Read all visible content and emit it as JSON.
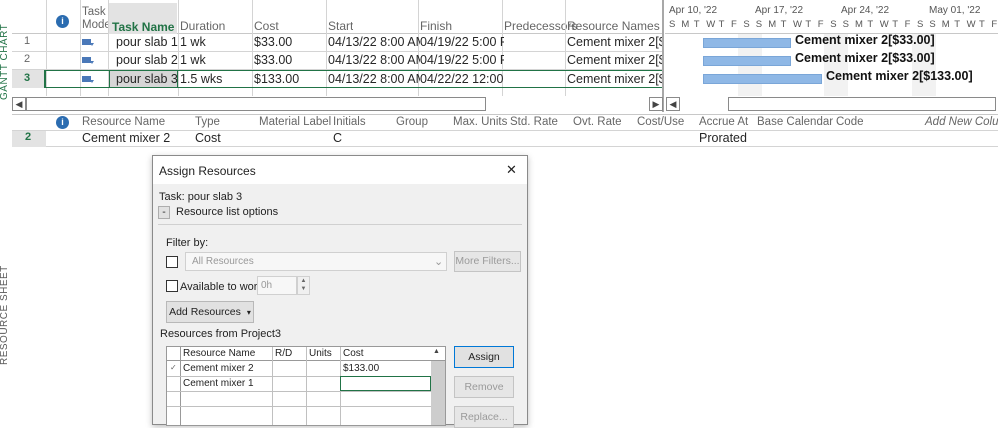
{
  "side_labels": {
    "gantt": "GANTT CHART",
    "resource_sheet": "RESOURCE SHEET"
  },
  "task_table": {
    "headers": {
      "info": "i",
      "mode": "Task Mode",
      "name": "Task Name",
      "duration": "Duration",
      "cost": "Cost",
      "start": "Start",
      "finish": "Finish",
      "predecessors": "Predecessors",
      "resource_names": "Resource Names"
    },
    "rows": [
      {
        "id": "1",
        "name": "pour slab 1",
        "duration": "1 wk",
        "cost": "$33.00",
        "start": "04/13/22 8:00 AM",
        "finish": "04/19/22 5:00 P",
        "resources": "Cement mixer 2[$3"
      },
      {
        "id": "2",
        "name": "pour slab 2",
        "duration": "1 wk",
        "cost": "$33.00",
        "start": "04/13/22 8:00 AM",
        "finish": "04/19/22 5:00 P",
        "resources": "Cement mixer 2[$3"
      },
      {
        "id": "3",
        "name": "pour slab 3",
        "duration": "1.5 wks",
        "cost": "$133.00",
        "start": "04/13/22 8:00 AM",
        "finish": "04/22/22 12:00",
        "resources": "Cement mixer 2[$1"
      }
    ]
  },
  "timeline": {
    "weeks": [
      "Apr 10, '22",
      "Apr 17, '22",
      "Apr 24, '22",
      "May 01, '22"
    ],
    "days": [
      "S",
      "M",
      "T",
      "W",
      "T",
      "F",
      "S",
      "S",
      "M",
      "T",
      "W",
      "T",
      "F",
      "S",
      "S",
      "M",
      "T",
      "W",
      "T",
      "F",
      "S",
      "S",
      "M",
      "T",
      "W",
      "T",
      "F",
      "S"
    ],
    "bars": [
      {
        "label": "Cement mixer 2[$33.00]"
      },
      {
        "label": "Cement mixer 2[$33.00]"
      },
      {
        "label": "Cement mixer 2[$133.00]"
      }
    ]
  },
  "resource_sheet": {
    "headers": {
      "info": "i",
      "name": "Resource Name",
      "type": "Type",
      "material": "Material Label",
      "initials": "Initials",
      "group": "Group",
      "max_units": "Max. Units",
      "std_rate": "Std. Rate",
      "ovt_rate": "Ovt. Rate",
      "cost_use": "Cost/Use",
      "accrue": "Accrue At",
      "calendar": "Base Calendar",
      "code": "Code",
      "add_col": "Add New Colum"
    },
    "row": {
      "id": "2",
      "name": "Cement mixer 2",
      "type": "Cost",
      "initials": "C",
      "accrue": "Prorated"
    }
  },
  "dialog": {
    "title": "Assign Resources",
    "close": "✕",
    "task_label": "Task: pour slab 3",
    "collapse": "-",
    "options_label": "Resource list options",
    "filter_by": "Filter by:",
    "filter_value": "All Resources",
    "more_filters": "More Filters...",
    "available_label": "Available to work",
    "available_value": "0h",
    "add_resources": "Add Resources",
    "resources_from": "Resources from Project3",
    "columns": [
      "Resource Name",
      "R/D",
      "Units",
      "Cost"
    ],
    "rows": [
      {
        "check": "✓",
        "name": "Cement mixer 2",
        "rd": "",
        "units": "",
        "cost": "$133.00"
      },
      {
        "check": "",
        "name": "Cement mixer 1",
        "rd": "",
        "units": "",
        "cost": ""
      }
    ],
    "assign": "Assign",
    "remove": "Remove",
    "replace": "Replace..."
  }
}
